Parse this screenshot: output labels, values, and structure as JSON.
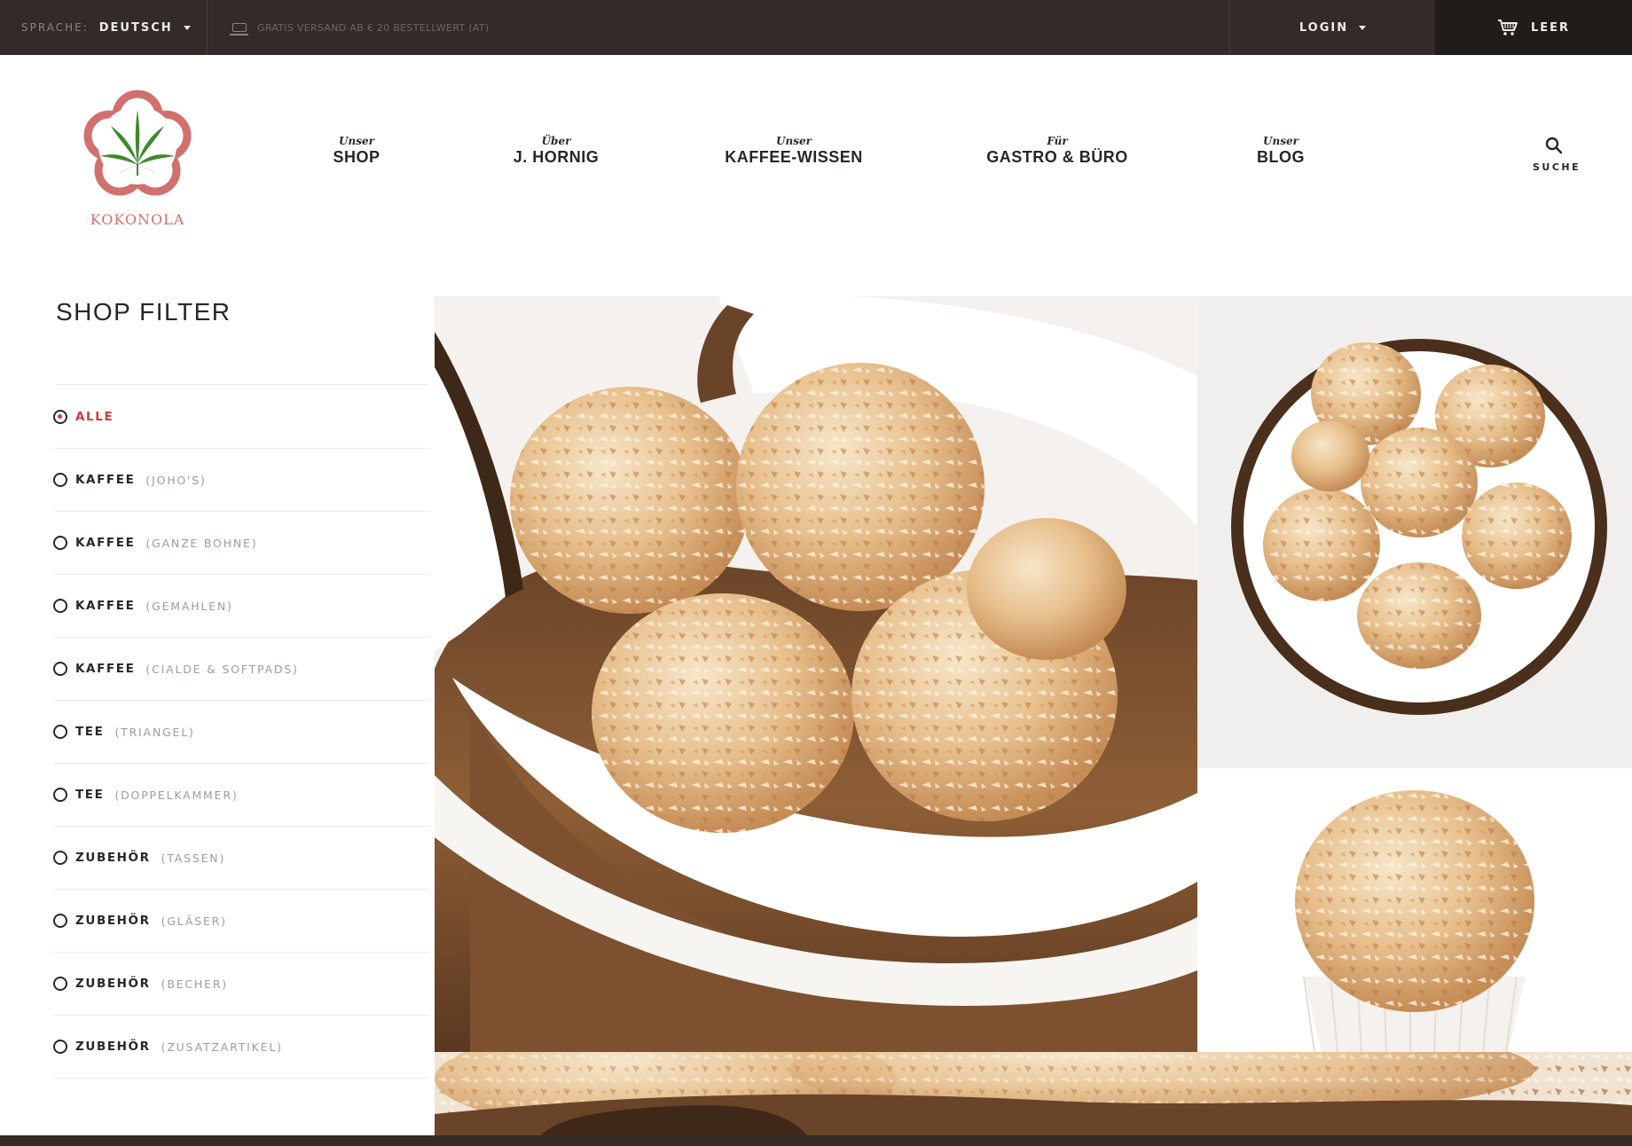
{
  "topbar": {
    "language_label": "SPRACHE:",
    "language_value": "DEUTSCH",
    "shipping_note": "GRATIS VERSAND AB € 20 BESTELLWERT (AT)",
    "login_label": "LOGIN",
    "cart_label": "LEER"
  },
  "brand": {
    "name": "KOKONOLA"
  },
  "nav": {
    "items": [
      {
        "pre": "Unser",
        "label": "SHOP"
      },
      {
        "pre": "Über",
        "label": "J. HORNIG"
      },
      {
        "pre": "Unser",
        "label": "KAFFEE-WISSEN"
      },
      {
        "pre": "Für",
        "label": "GASTRO & BÜRO"
      },
      {
        "pre": "Unser",
        "label": "BLOG"
      }
    ],
    "search_label": "SUCHE"
  },
  "filter": {
    "title": "SHOP FILTER",
    "items": [
      {
        "category": "ALLE",
        "sub": "",
        "active": true
      },
      {
        "category": "KAFFEE",
        "sub": "(JOHO'S)",
        "active": false
      },
      {
        "category": "KAFFEE",
        "sub": "(GANZE BOHNE)",
        "active": false
      },
      {
        "category": "KAFFEE",
        "sub": "(GEMAHLEN)",
        "active": false
      },
      {
        "category": "KAFFEE",
        "sub": "(CIALDE & SOFTPADS)",
        "active": false
      },
      {
        "category": "TEE",
        "sub": "(TRIANGEL)",
        "active": false
      },
      {
        "category": "TEE",
        "sub": "(DOPPELKAMMER)",
        "active": false
      },
      {
        "category": "ZUBEHÖR",
        "sub": "(TASSEN)",
        "active": false
      },
      {
        "category": "ZUBEHÖR",
        "sub": "(GLÄSER)",
        "active": false
      },
      {
        "category": "ZUBEHÖR",
        "sub": "(BECHER)",
        "active": false
      },
      {
        "category": "ZUBEHÖR",
        "sub": "(ZUSATZARTIKEL)",
        "active": false
      }
    ]
  },
  "colors": {
    "topbar": "#322b27",
    "cart_bg": "#211c19",
    "accent_red": "#d23a36",
    "logo_pink": "#d1706d",
    "leaf_green": "#3f8a2c"
  },
  "icons": {
    "laptop": "laptop-icon",
    "cart": "cart-icon",
    "search": "search-icon",
    "logo": "cannabis-leaf-flower-logo"
  }
}
